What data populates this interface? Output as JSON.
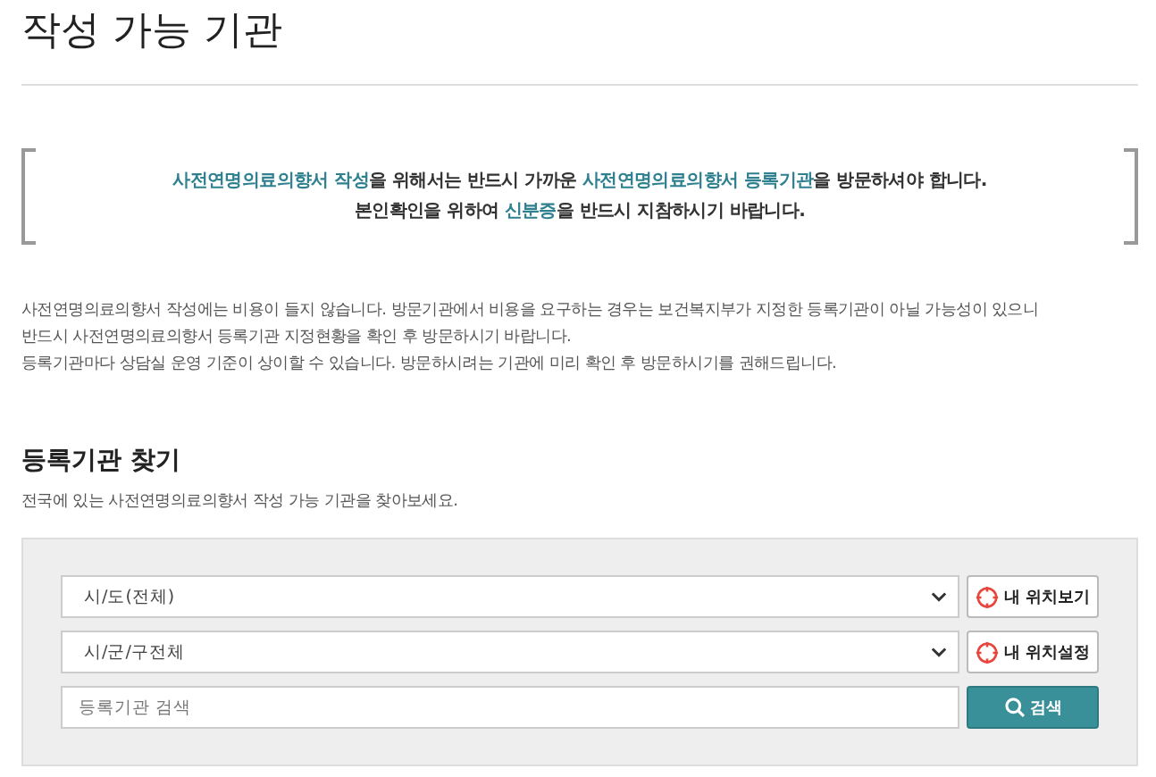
{
  "title": "작성 가능 기관",
  "notice": [
    [
      {
        "text": "사전연명의료의향서 작성",
        "highlight": true
      },
      {
        "text": "을 위해서는 반드시 가까운 ",
        "highlight": false
      },
      {
        "text": "사전연명의료의향서 등록기관",
        "highlight": true
      },
      {
        "text": "을 방문하셔야 합니다.",
        "highlight": false
      }
    ],
    [
      {
        "text": "본인확인을 위하여 ",
        "highlight": false
      },
      {
        "text": "신분증",
        "highlight": true
      },
      {
        "text": "을 반드시 지참하시기 바랍니다.",
        "highlight": false
      }
    ]
  ],
  "info_lines": [
    "사전연명의료의향서 작성에는 비용이 들지 않습니다. 방문기관에서 비용을 요구하는 경우는 보건복지부가 지정한 등록기관이 아닐 가능성이 있으니",
    "반드시 사전연명의료의향서 등록기관 지정현황을 확인 후 방문하시기 바랍니다.",
    "등록기관마다 상담실 운영 기준이 상이할 수 있습니다. 방문하시려는 기관에 미리 확인 후 방문하시기를 권해드립니다."
  ],
  "section": {
    "heading": "등록기관 찾기",
    "subtitle": "전국에 있는 사전연명의료의향서 작성 가능 기관을 찾아보세요."
  },
  "search_rows": [
    {
      "kind": "select",
      "value": "시/도(전체)",
      "button": "내 위치보기"
    },
    {
      "kind": "select",
      "value": "시/군/구전체",
      "button": "내 위치설정"
    },
    {
      "kind": "input",
      "placeholder": "등록기관 검색",
      "button": "검색"
    }
  ]
}
